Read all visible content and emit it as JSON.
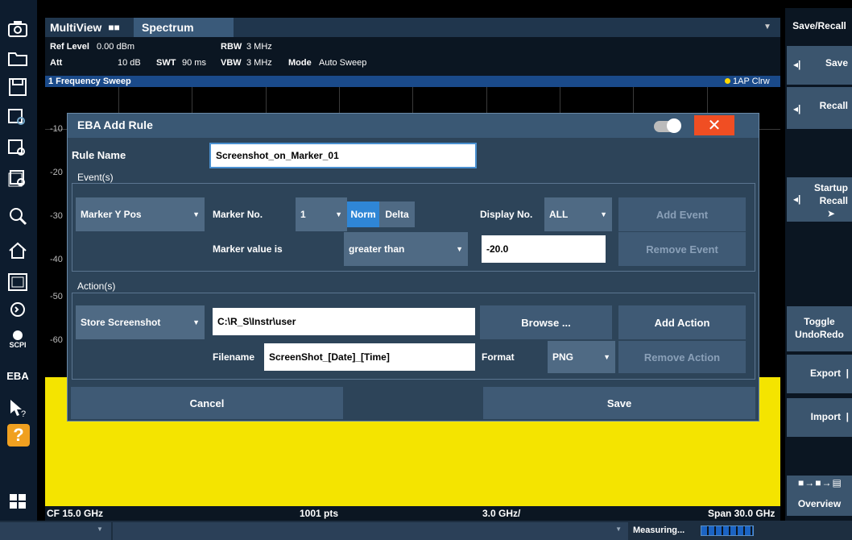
{
  "tabs": {
    "multiview": "MultiView",
    "spectrum": "Spectrum"
  },
  "params": {
    "ref_level_label": "Ref Level",
    "ref_level_value": "0.00 dBm",
    "att_label": "Att",
    "att_value": "10 dB",
    "swt_label": "SWT",
    "swt_value": "90 ms",
    "rbw_label": "RBW",
    "rbw_value": "3 MHz",
    "vbw_label": "VBW",
    "vbw_value": "3 MHz",
    "mode_label": "Mode",
    "mode_value": "Auto Sweep"
  },
  "sweep": {
    "title": "1 Frequency Sweep",
    "trace": "1AP Clrw"
  },
  "y_ticks": [
    "-10",
    "-20",
    "-30",
    "-40",
    "-50",
    "-60"
  ],
  "plot_footer": {
    "cf": "CF 15.0 GHz",
    "pts": "1001 pts",
    "div": "3.0 GHz/",
    "span": "Span 30.0 GHz"
  },
  "status": {
    "measuring": "Measuring..."
  },
  "left_toolbar": {
    "ebi": "EBA",
    "scpi": "SCPI",
    "help": "?"
  },
  "softkeys": {
    "title": "Save/Recall",
    "save": "Save",
    "recall": "Recall",
    "startup_recall_1": "Startup",
    "startup_recall_2": "Recall",
    "toggle_1": "Toggle",
    "toggle_2": "UndoRedo",
    "export": "Export",
    "import": "Import",
    "overview": "Overview"
  },
  "dialog": {
    "title": "EBA Add Rule",
    "rule_name_label": "Rule Name",
    "rule_name_value": "Screenshot_on_Marker_01",
    "events_title": "Event(s)",
    "event_type": "Marker Y Pos",
    "marker_no_label": "Marker No.",
    "marker_no_value": "1",
    "norm": "Norm",
    "delta": "Delta",
    "display_no_label": "Display No.",
    "display_no_value": "ALL",
    "add_event": "Add Event",
    "marker_value_label": "Marker value is",
    "comparison": "greater than",
    "threshold": "-20.0",
    "remove_event": "Remove Event",
    "actions_title": "Action(s)",
    "action_type": "Store Screenshot",
    "path": "C:\\R_S\\Instr\\user",
    "browse": "Browse ...",
    "add_action": "Add Action",
    "filename_label": "Filename",
    "filename_value": "ScreenShot_[Date]_[Time]",
    "format_label": "Format",
    "format_value": "PNG",
    "remove_action": "Remove Action",
    "cancel": "Cancel",
    "save": "Save"
  }
}
